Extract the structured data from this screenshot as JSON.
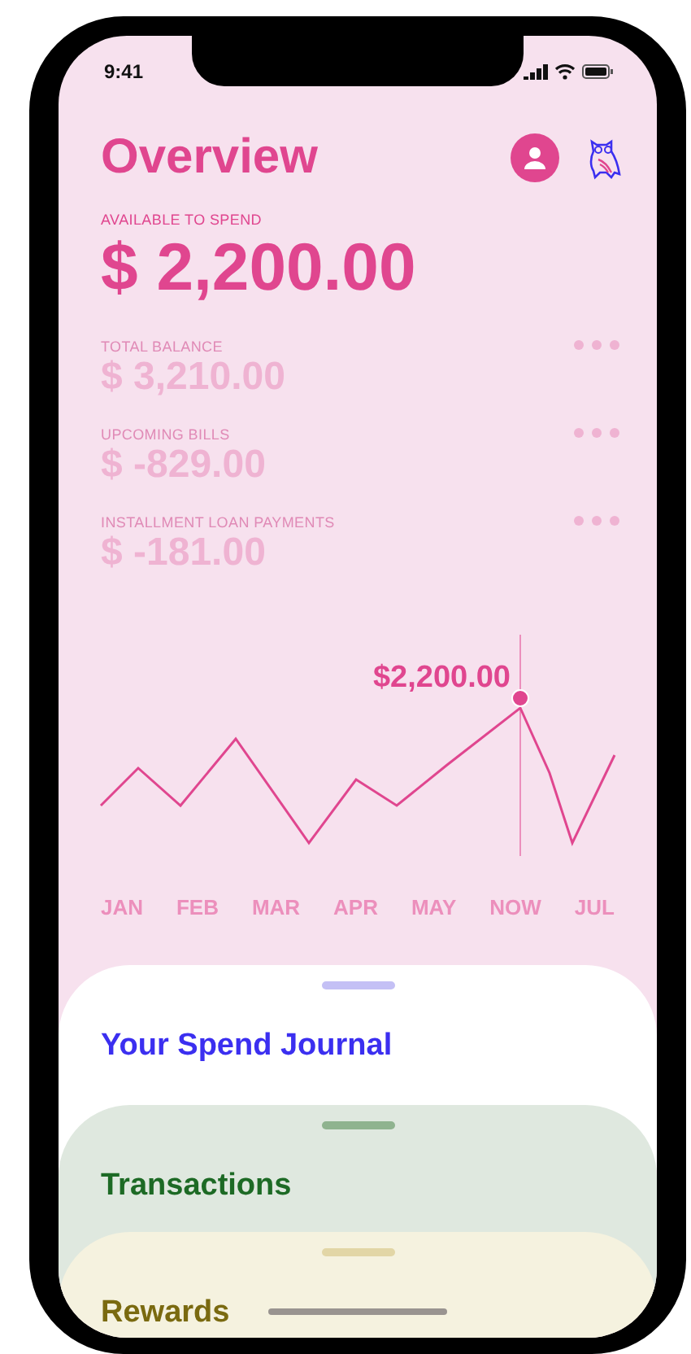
{
  "status_bar": {
    "time": "9:41"
  },
  "header": {
    "title": "Overview"
  },
  "available": {
    "label": "AVAILABLE TO SPEND",
    "amount": "$ 2,200.00"
  },
  "balances": [
    {
      "label": "TOTAL BALANCE",
      "amount": "$ 3,210.00"
    },
    {
      "label": "UPCOMING BILLS",
      "amount": "$ -829.00"
    },
    {
      "label": "INSTALLMENT LOAN PAYMENTS",
      "amount": "$ -181.00"
    }
  ],
  "chart": {
    "highlight_label": "$2,200.00",
    "months": [
      "JAN",
      "FEB",
      "MAR",
      "APR",
      "MAY",
      "NOW",
      "JUL"
    ]
  },
  "sheets": [
    {
      "title": "Your Spend Journal",
      "color": "#3b2ff0"
    },
    {
      "title": "Transactions",
      "color": "#1d6a25"
    },
    {
      "title": "Rewards",
      "color": "#7a6a10"
    }
  ]
}
